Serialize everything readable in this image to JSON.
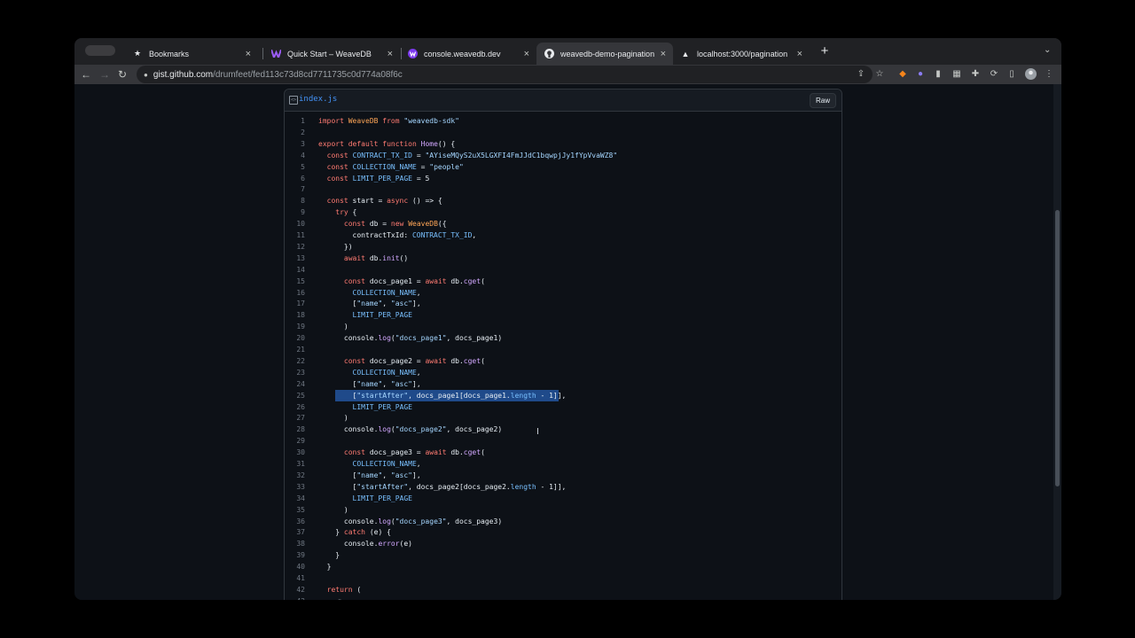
{
  "browser": {
    "tabs": [
      {
        "title": "Bookmarks",
        "icon": "star-icon",
        "active": false
      },
      {
        "title": "Quick Start – WeaveDB",
        "icon": "weavedb-icon",
        "active": false
      },
      {
        "title": "console.weavedb.dev",
        "icon": "weavedb-console-icon",
        "active": false
      },
      {
        "title": "weavedb-demo-pagination",
        "icon": "github-icon",
        "active": true
      },
      {
        "title": "localhost:3000/pagination",
        "icon": "triangle-icon",
        "active": false
      }
    ],
    "url_host": "gist.github.com",
    "url_path": "/drumfeet/fed113c73d8cd7711735c0d774a08f6c"
  },
  "file": {
    "name": "index.js",
    "raw_label": "Raw"
  },
  "code_lines": [
    "import WeaveDB from \"weavedb-sdk\"",
    "",
    "export default function Home() {",
    "  const CONTRACT_TX_ID = \"AYiseMQyS2uX5LGXFI4FmJJdC1bqwpjJy1fYpVvaWZ8\"",
    "  const COLLECTION_NAME = \"people\"",
    "  const LIMIT_PER_PAGE = 5",
    "",
    "  const start = async () => {",
    "    try {",
    "      const db = new WeaveDB({",
    "        contractTxId: CONTRACT_TX_ID,",
    "      })",
    "      await db.init()",
    "",
    "      const docs_page1 = await db.cget(",
    "        COLLECTION_NAME,",
    "        [\"name\", \"asc\"],",
    "        LIMIT_PER_PAGE",
    "      )",
    "      console.log(\"docs_page1\", docs_page1)",
    "",
    "      const docs_page2 = await db.cget(",
    "        COLLECTION_NAME,",
    "        [\"name\", \"asc\"],",
    "        [\"startAfter\", docs_page1[docs_page1.length - 1]],",
    "        LIMIT_PER_PAGE",
    "      )",
    "      console.log(\"docs_page2\", docs_page2)",
    "",
    "      const docs_page3 = await db.cget(",
    "        COLLECTION_NAME,",
    "        [\"name\", \"asc\"],",
    "        [\"startAfter\", docs_page2[docs_page2.length - 1]],",
    "        LIMIT_PER_PAGE",
    "      )",
    "      console.log(\"docs_page3\", docs_page3)",
    "    } catch (e) {",
    "      console.error(e)",
    "    }",
    "  }",
    "",
    "  return (",
    "    <>"
  ],
  "selected_line": 25,
  "colors": {
    "keyword": "#ff7b72",
    "string": "#a5d6ff",
    "constant": "#79c0ff",
    "function": "#d2a8ff",
    "class": "#ffa657",
    "selection": "#1f4a8a",
    "link": "#4493f8"
  }
}
